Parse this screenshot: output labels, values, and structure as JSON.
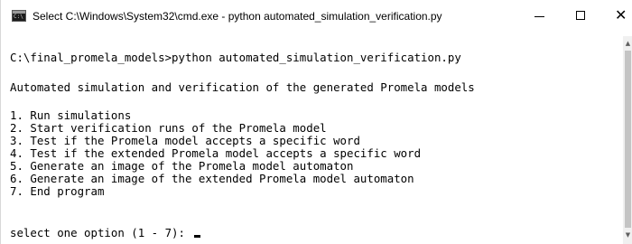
{
  "window": {
    "title": "Select C:\\Windows\\System32\\cmd.exe - python  automated_simulation_verification.py",
    "icon": "cmd-icon",
    "icon_text": "C:\\",
    "controls": {
      "minimize": "minimize-icon",
      "maximize": "maximize-icon",
      "close_glyph": "✕"
    }
  },
  "console": {
    "command_line": "C:\\final_promela_models>python automated_simulation_verification.py",
    "header": "Automated simulation and verification of the generated Promela models",
    "menu": [
      "1. Run simulations",
      "2. Start verification runs of the Promela model",
      "3. Test if the Promela model accepts a specific word",
      "4. Test if the extended Promela model accepts a specific word",
      "5. Generate an image of the Promela model automaton",
      "6. Generate an image of the extended Promela model automaton",
      "7. End program"
    ],
    "prompt": "select one option (1 - 7): "
  },
  "scrollbar": {
    "up_glyph": "▲",
    "down_glyph": "▼"
  },
  "colors": {
    "background": "#ffffff",
    "text": "#000000",
    "scrollbar_track": "#f0f0f0",
    "scrollbar_thumb": "#c4c4c4"
  }
}
